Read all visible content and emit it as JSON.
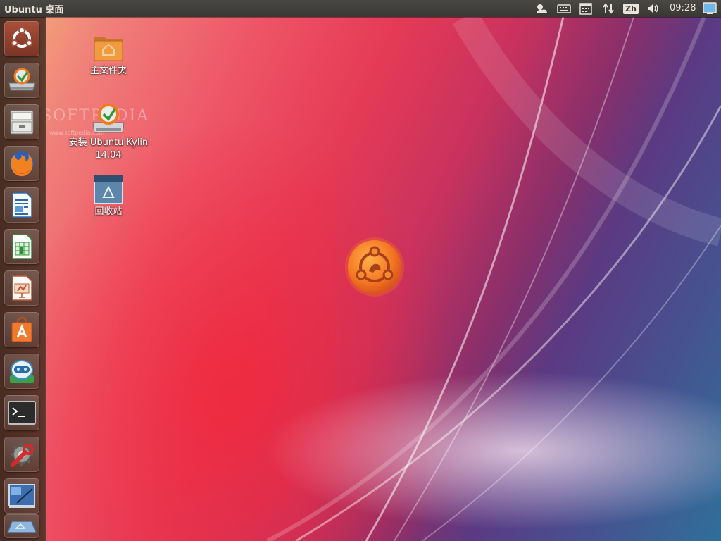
{
  "panel": {
    "title": "Ubuntu 桌面",
    "language": "Zh",
    "clock": "09:28"
  },
  "launcher": {
    "items": [
      {
        "name": "dash-home",
        "icon": "ubuntu-logo-icon"
      },
      {
        "name": "install-ubuntu-kylin",
        "icon": "installer-drive-icon"
      },
      {
        "name": "files",
        "icon": "file-cabinet-icon"
      },
      {
        "name": "firefox",
        "icon": "firefox-icon"
      },
      {
        "name": "libreoffice-writer",
        "icon": "writer-document-icon"
      },
      {
        "name": "libreoffice-calc",
        "icon": "calc-spreadsheet-icon"
      },
      {
        "name": "libreoffice-impress",
        "icon": "impress-presentation-icon"
      },
      {
        "name": "software-center",
        "icon": "software-bag-icon"
      },
      {
        "name": "kylin-assistant",
        "icon": "robot-assistant-icon"
      },
      {
        "name": "terminal",
        "icon": "terminal-icon"
      },
      {
        "name": "system-settings",
        "icon": "wrench-settings-icon"
      },
      {
        "name": "workspace-switcher",
        "icon": "workspace-switcher-icon"
      },
      {
        "name": "trash",
        "icon": "trash-icon"
      }
    ]
  },
  "desktop": {
    "icons": [
      {
        "label": "主文件夹",
        "icon": "home-folder-icon"
      },
      {
        "label": "安装 Ubuntu Kylin 14.04",
        "icon": "installer-drive-icon"
      },
      {
        "label": "回收站",
        "icon": "trash-bin-icon"
      }
    ],
    "watermark": "SOFTPEDIA",
    "watermark_url": "www.softpedia.com"
  },
  "colors": {
    "panel_bg": "#3c3b37",
    "ubuntu_orange": "#f47421",
    "launcher_bg": "#4e3024"
  }
}
